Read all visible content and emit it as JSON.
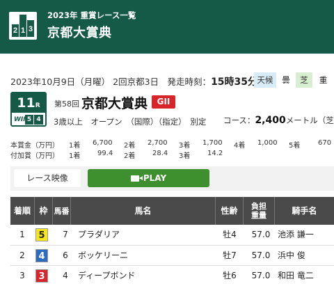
{
  "header": {
    "subtitle": "2023年 重賞レース一覧",
    "title": "京都大賞典",
    "logo": {
      "d1": "2",
      "d2": "1",
      "d3": "3"
    }
  },
  "race_info": {
    "date_place": "2023年10月9日（月曜） 2回京都3日　発走時刻：",
    "start_time": "15時35分",
    "weather_label": "天候",
    "weather_value": "曇",
    "track_label": "芝",
    "track_value": "重"
  },
  "race": {
    "number": "11",
    "number_suffix": "R",
    "win5_prefix": "WIN",
    "win5_num": "5",
    "win5_leg": "4",
    "edition": "第58回",
    "name": "京都大賞典",
    "grade": "GII",
    "conditions": "3歳以上　オープン　（国際）（指定）　別定",
    "course_label": "コース：",
    "distance": "2,400",
    "course_suffix": "メートル（芝・右"
  },
  "prize": {
    "main_label": "本賞金（万円）",
    "main": [
      {
        "place": "1着",
        "amount": "6,700"
      },
      {
        "place": "2着",
        "amount": "2,700"
      },
      {
        "place": "3着",
        "amount": "1,700"
      },
      {
        "place": "4着",
        "amount": "1,000"
      },
      {
        "place": "5着",
        "amount": "670"
      }
    ],
    "add_label": "付加賞（万円）",
    "add": [
      {
        "place": "1着",
        "amount": "99.4"
      },
      {
        "place": "2着",
        "amount": "28.4"
      },
      {
        "place": "3着",
        "amount": "14.2"
      }
    ]
  },
  "video": {
    "label": "レース映像",
    "play_label": "PLAY"
  },
  "table": {
    "headers": {
      "rank": "着順",
      "waku": "枠",
      "uma": "馬番",
      "name": "馬名",
      "age": "性齢",
      "weight": "負担重量",
      "jockey": "騎手名"
    },
    "rows": [
      {
        "rank": "1",
        "waku": "5",
        "waku_color": "#f5e51b",
        "waku_text": "#222",
        "uma": "7",
        "name": "プラダリア",
        "age": "牡4",
        "weight": "57.0",
        "jockey": "池添 謙一"
      },
      {
        "rank": "2",
        "waku": "4",
        "waku_color": "#2f6ac1",
        "waku_text": "#fff",
        "uma": "6",
        "name": "ボッケリーニ",
        "age": "牡7",
        "weight": "57.0",
        "jockey": "浜中 俊"
      },
      {
        "rank": "3",
        "waku": "3",
        "waku_color": "#d8242b",
        "waku_text": "#fff",
        "uma": "4",
        "name": "ディープボンド",
        "age": "牡6",
        "weight": "57.0",
        "jockey": "和田 竜二"
      }
    ]
  },
  "colors": {
    "brand_green": "#145a46",
    "play_green": "#3e8f2e",
    "grade_red": "#d8242b"
  }
}
